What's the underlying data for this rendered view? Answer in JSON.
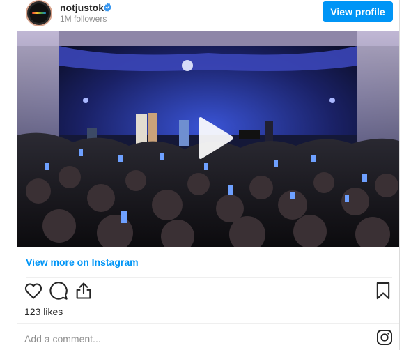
{
  "header": {
    "username": "notjustok",
    "followers": "1M followers",
    "view_profile_label": "View profile",
    "verified_icon": "verified-badge-icon",
    "avatar_icon": "profile-avatar"
  },
  "media": {
    "type": "video",
    "play_icon": "play-icon",
    "description_colors": {
      "stage_light": "#3a54d6",
      "curtain": "#b4a9c9"
    }
  },
  "links": {
    "view_more": "View more on Instagram"
  },
  "actions": {
    "like_icon": "heart-icon",
    "comment_icon": "comment-icon",
    "share_icon": "share-icon",
    "save_icon": "bookmark-icon"
  },
  "stats": {
    "likes": "123 likes"
  },
  "comment": {
    "placeholder": "Add a comment..."
  },
  "footer": {
    "logo_icon": "instagram-icon"
  },
  "colors": {
    "accent": "#0095f6",
    "text": "#262626",
    "muted": "#8e8e8e",
    "border": "#dbdbdb"
  }
}
